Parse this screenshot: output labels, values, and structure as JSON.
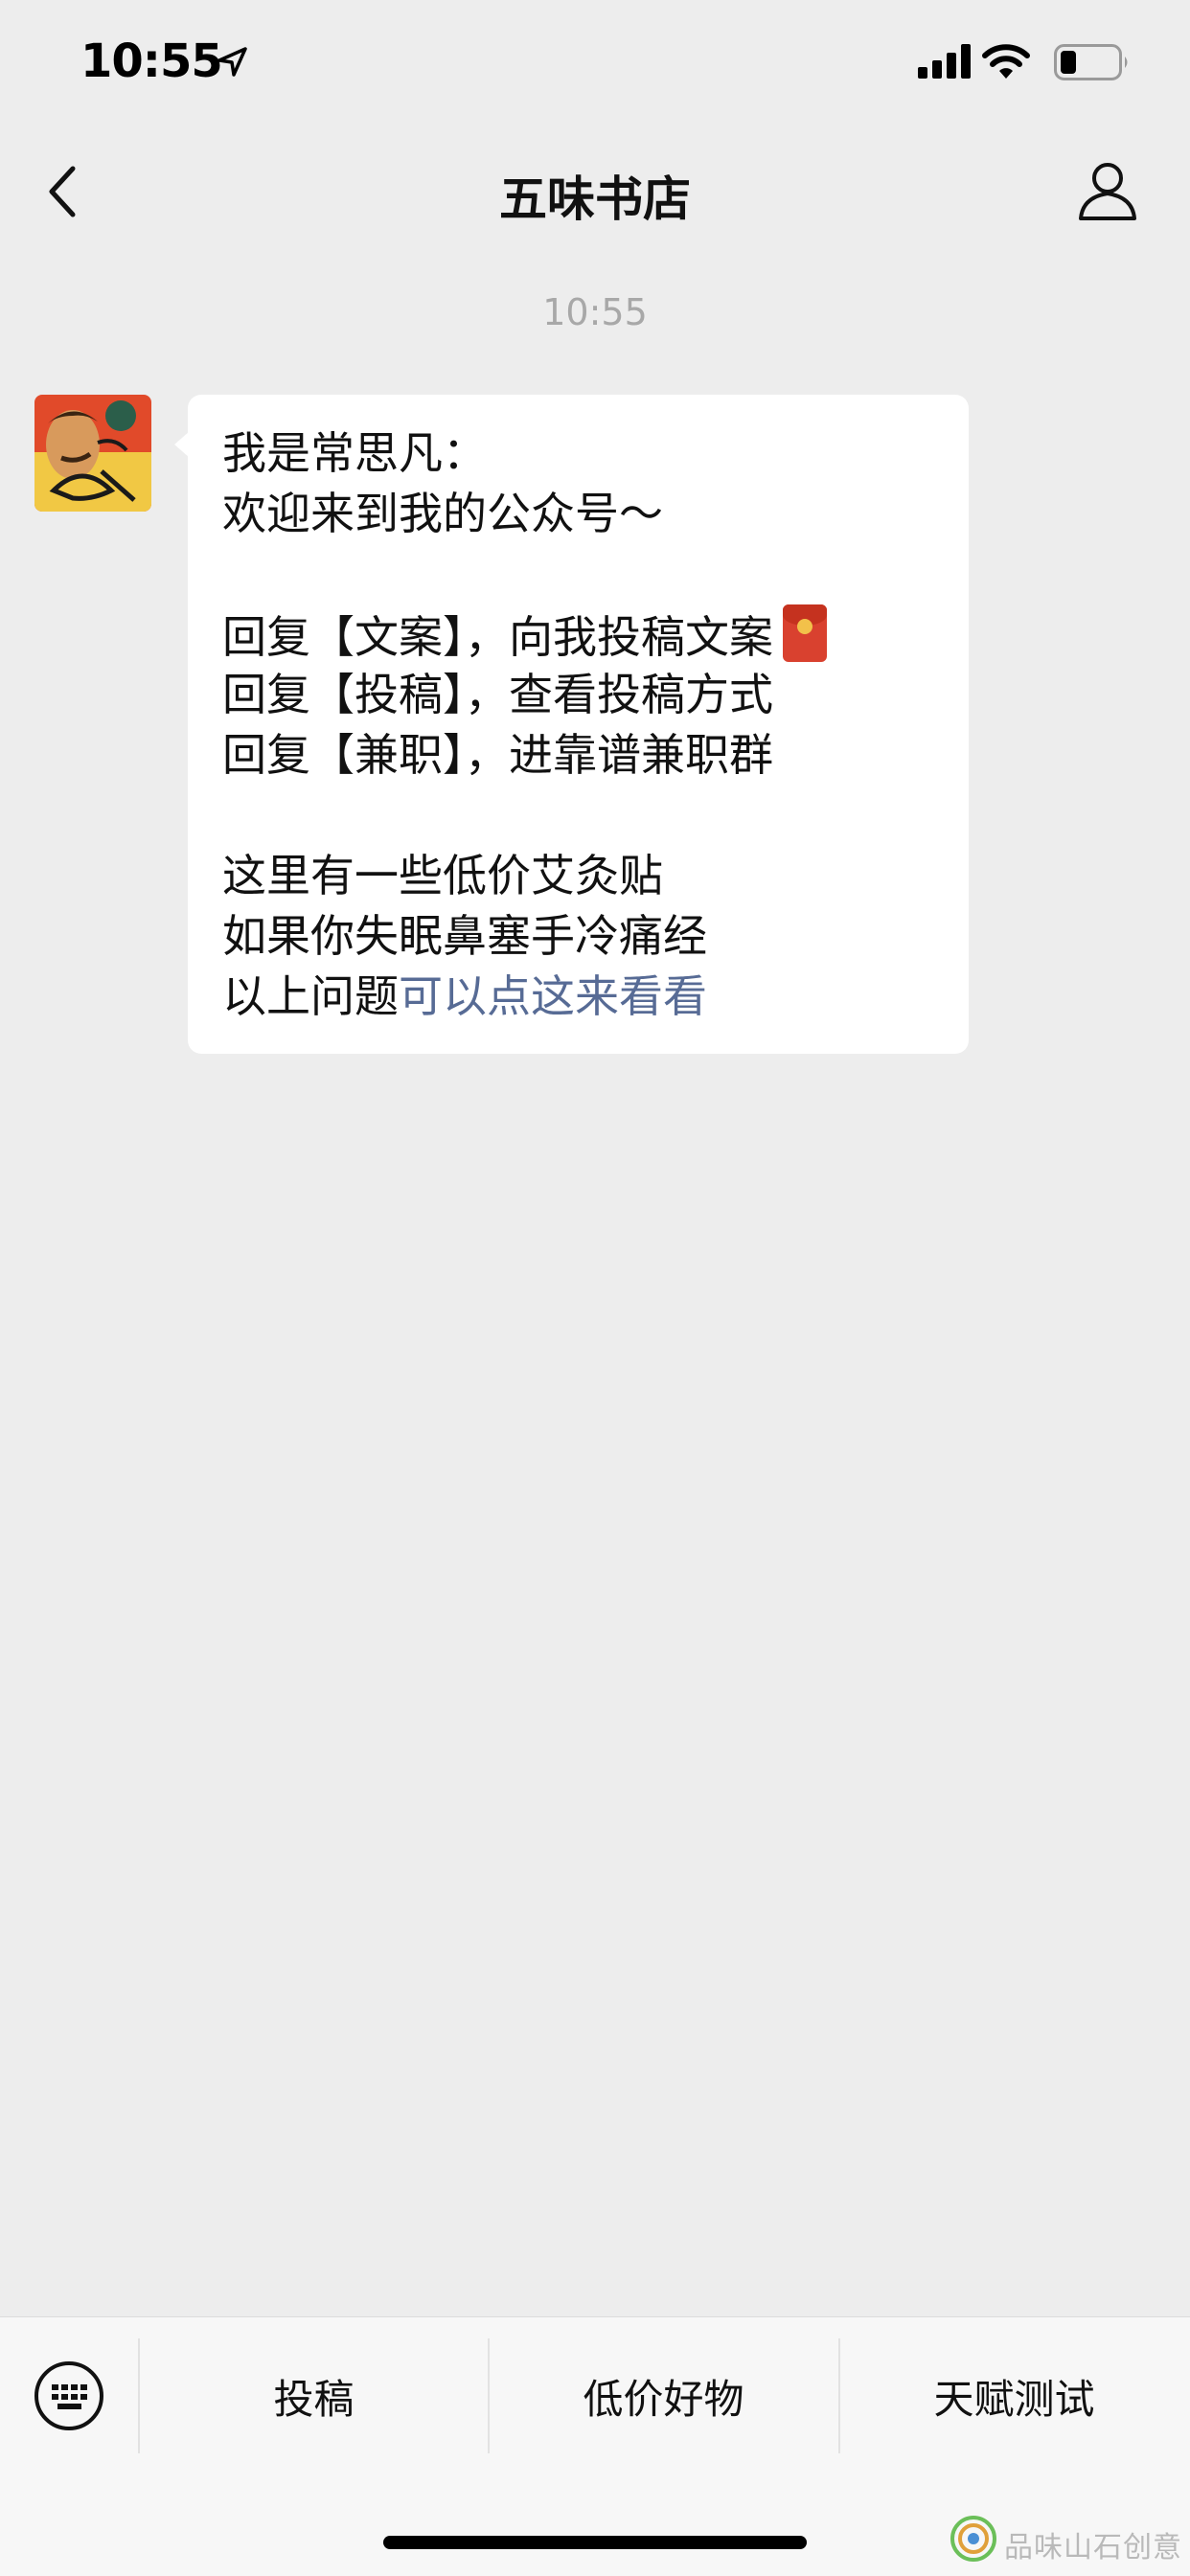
{
  "status_bar": {
    "time": "10:55",
    "icons": [
      "location-arrow-icon",
      "cellular-signal-icon",
      "wifi-icon",
      "battery-icon"
    ]
  },
  "nav": {
    "title": "五味书店",
    "back_icon": "chevron-left-icon",
    "profile_icon": "person-icon"
  },
  "chat": {
    "timestamp": "10:55",
    "message": {
      "lines": [
        "我是常思凡：",
        "欢迎来到我的公众号～",
        "",
        "回复【文案】，向我投稿文案",
        "回复【投稿】，查看投稿方式",
        "回复【兼职】，进靠谱兼职群",
        "",
        "这里有一些低价艾灸贴",
        "如果你失眠鼻塞手冷痛经",
        "以上问题"
      ],
      "link_text": "可以点这来看看",
      "emoji": "red-packet-icon"
    }
  },
  "bottom_menu": {
    "keyboard_icon": "keyboard-icon",
    "items": [
      "投稿",
      "低价好物",
      "天赋测试"
    ]
  },
  "colors": {
    "background": "#ededed",
    "bubble": "#ffffff",
    "link": "#576b95",
    "menu_bg": "#f7f7f7"
  }
}
